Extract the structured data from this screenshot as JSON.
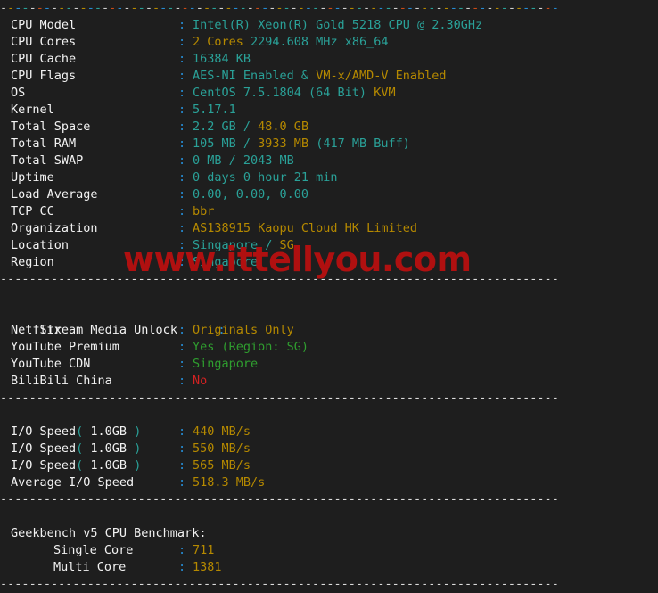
{
  "terminal": {
    "background": "#1e1e1e",
    "label_color": "#f2f2f2",
    "colon_color": "#268bd2",
    "cyan": "#2aa198",
    "gold": "#b58900",
    "green": "#2f9e2f",
    "red": "#d32222",
    "separator_char": "-"
  },
  "watermark": {
    "text": "www.ittellyou.com",
    "color": "#b01010"
  },
  "system_info": {
    "rows": [
      {
        "label": "CPU Model",
        "parts": [
          {
            "text": "Intel(R) Xeon(R) Gold 5218 CPU @ 2.30GHz",
            "color": "cyan"
          }
        ]
      },
      {
        "label": "CPU Cores",
        "parts": [
          {
            "text": "2 Cores",
            "color": "gold"
          },
          {
            "text": " 2294.608 MHz x86_64",
            "color": "cyan"
          }
        ]
      },
      {
        "label": "CPU Cache",
        "parts": [
          {
            "text": "16384 KB",
            "color": "cyan"
          }
        ]
      },
      {
        "label": "CPU Flags",
        "parts": [
          {
            "text": "AES-NI Enabled",
            "color": "cyan"
          },
          {
            "text": " & ",
            "color": "cyan"
          },
          {
            "text": "VM-x/AMD-V Enabled",
            "color": "gold"
          }
        ]
      },
      {
        "label": "OS",
        "parts": [
          {
            "text": "CentOS 7.5.1804 (64 Bit) ",
            "color": "cyan"
          },
          {
            "text": "KVM",
            "color": "gold"
          }
        ]
      },
      {
        "label": "Kernel",
        "parts": [
          {
            "text": "5.17.1",
            "color": "cyan"
          }
        ]
      },
      {
        "label": "Total Space",
        "parts": [
          {
            "text": "2.2 GB",
            "color": "cyan"
          },
          {
            "text": " / ",
            "color": "cyan"
          },
          {
            "text": "48.0 GB",
            "color": "gold"
          }
        ]
      },
      {
        "label": "Total RAM",
        "parts": [
          {
            "text": "105 MB",
            "color": "cyan"
          },
          {
            "text": " / ",
            "color": "cyan"
          },
          {
            "text": "3933 MB",
            "color": "gold"
          },
          {
            "text": " (417 MB Buff)",
            "color": "cyan"
          }
        ]
      },
      {
        "label": "Total SWAP",
        "parts": [
          {
            "text": "0 MB / 2043 MB",
            "color": "cyan"
          }
        ]
      },
      {
        "label": "Uptime",
        "parts": [
          {
            "text": "0 days 0 hour 21 min",
            "color": "cyan"
          }
        ]
      },
      {
        "label": "Load Average",
        "parts": [
          {
            "text": "0.00, 0.00, 0.00",
            "color": "cyan"
          }
        ]
      },
      {
        "label": "TCP CC",
        "parts": [
          {
            "text": "bbr",
            "color": "gold"
          }
        ]
      },
      {
        "label": "Organization",
        "parts": [
          {
            "text": "AS138915 Kaopu Cloud HK Limited",
            "color": "gold"
          }
        ]
      },
      {
        "label": "Location",
        "parts": [
          {
            "text": "Singapore",
            "color": "cyan"
          },
          {
            "text": " / ",
            "color": "cyan"
          },
          {
            "text": "SG",
            "color": "gold"
          }
        ]
      },
      {
        "label": "Region",
        "parts": [
          {
            "text": "Singapore",
            "color": "cyan"
          }
        ]
      }
    ]
  },
  "stream_media": {
    "heading": "Stream Media Unlock",
    "rows": [
      {
        "label": "Netflix",
        "parts": [
          {
            "text": "Originals Only",
            "color": "gold"
          }
        ]
      },
      {
        "label": "YouTube Premium",
        "parts": [
          {
            "text": "Yes (Region: SG)",
            "color": "green"
          }
        ]
      },
      {
        "label": "YouTube CDN",
        "parts": [
          {
            "text": "Singapore",
            "color": "green"
          }
        ]
      },
      {
        "label": "BiliBili China",
        "parts": [
          {
            "text": "No",
            "color": "red"
          }
        ]
      }
    ]
  },
  "io_speed": {
    "rows": [
      {
        "label_parts": [
          {
            "text": "I/O Speed",
            "color": "white"
          },
          {
            "text": "(",
            "color": "cyan"
          },
          {
            "text": " 1.0GB ",
            "color": "white"
          },
          {
            "text": ")",
            "color": "cyan"
          }
        ],
        "parts": [
          {
            "text": "440 MB/s",
            "color": "gold"
          }
        ]
      },
      {
        "label_parts": [
          {
            "text": "I/O Speed",
            "color": "white"
          },
          {
            "text": "(",
            "color": "cyan"
          },
          {
            "text": " 1.0GB ",
            "color": "white"
          },
          {
            "text": ")",
            "color": "cyan"
          }
        ],
        "parts": [
          {
            "text": "550 MB/s",
            "color": "gold"
          }
        ]
      },
      {
        "label_parts": [
          {
            "text": "I/O Speed",
            "color": "white"
          },
          {
            "text": "(",
            "color": "cyan"
          },
          {
            "text": " 1.0GB ",
            "color": "white"
          },
          {
            "text": ")",
            "color": "cyan"
          }
        ],
        "parts": [
          {
            "text": "565 MB/s",
            "color": "gold"
          }
        ]
      },
      {
        "label_parts": [
          {
            "text": "Average I/O Speed",
            "color": "white"
          }
        ],
        "parts": [
          {
            "text": "518.3 MB/s",
            "color": "gold"
          }
        ]
      }
    ]
  },
  "geekbench": {
    "heading": "Geekbench v5 CPU Benchmark:",
    "rows": [
      {
        "label": "Single Core",
        "parts": [
          {
            "text": "711",
            "color": "gold"
          }
        ]
      },
      {
        "label": "Multi Core",
        "parts": [
          {
            "text": "1381",
            "color": "gold"
          }
        ]
      }
    ]
  }
}
